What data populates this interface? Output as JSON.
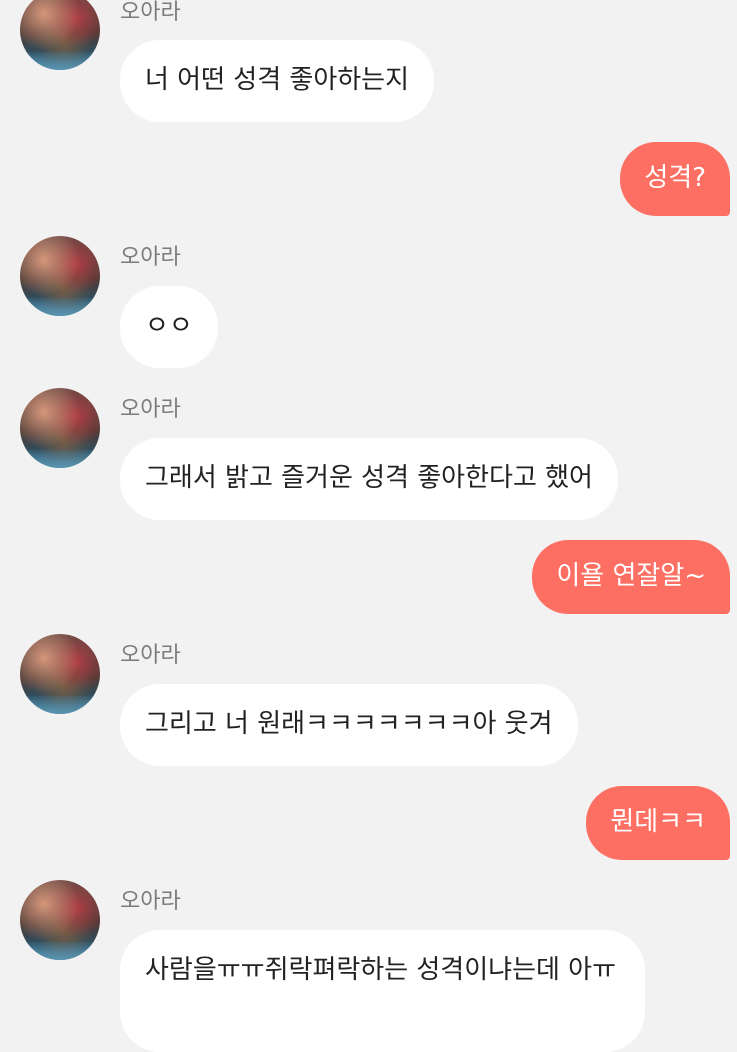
{
  "chat": {
    "messages": [
      {
        "from": "other",
        "sender": "오아라",
        "text": "너 어떤 성격 좋아하는지"
      },
      {
        "from": "me",
        "text": "성격?"
      },
      {
        "from": "other",
        "sender": "오아라",
        "text": "ㅇㅇ"
      },
      {
        "from": "other",
        "sender": "오아라",
        "text": "그래서 밝고 즐거운 성격 좋아한다고 했어"
      },
      {
        "from": "me",
        "text": "이욜 연잘알~"
      },
      {
        "from": "other",
        "sender": "오아라",
        "text": "그리고 너 원래ㅋㅋㅋㅋㅋㅋㅋ아 웃겨"
      },
      {
        "from": "me",
        "text": "뭔데ㅋㅋ"
      },
      {
        "from": "other",
        "sender": "오아라",
        "text": "사람을ㅠㅠ쥐락펴락하는 성격이냐는데 아ㅠ"
      }
    ]
  },
  "colors": {
    "background": "#f2f2f2",
    "incoming_bubble": "#ffffff",
    "outgoing_bubble": "#fc6f62",
    "sender_name": "#7b7b7b"
  }
}
